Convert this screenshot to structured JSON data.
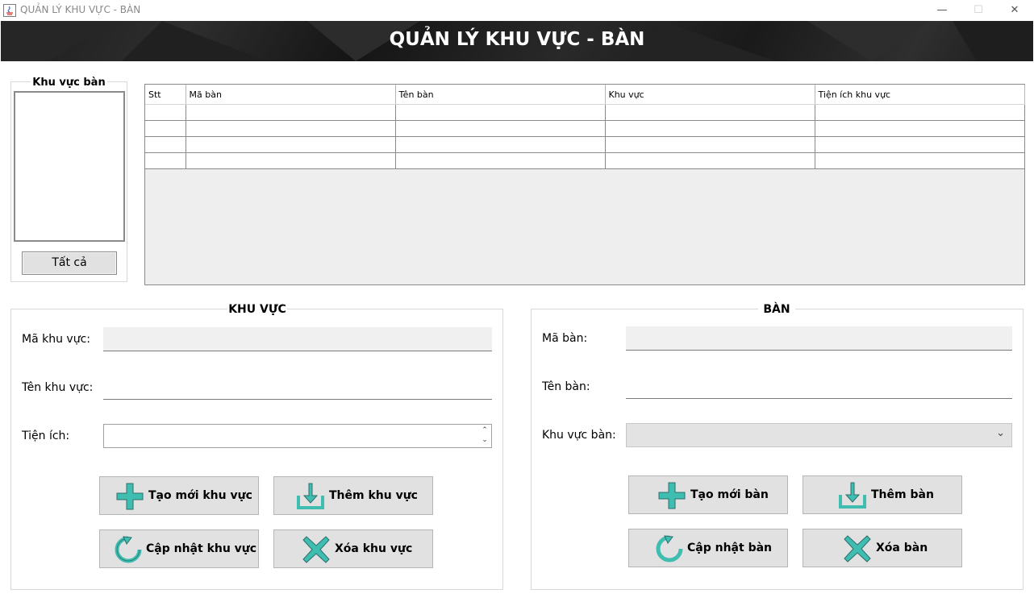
{
  "window": {
    "title": "QUẢN LÝ KHU VỰC - BÀN"
  },
  "window_controls": {
    "minimize": "—",
    "maximize": "☐",
    "close": "✕"
  },
  "banner": {
    "title": "QUẢN LÝ KHU VỰC - BÀN"
  },
  "area_panel": {
    "title": "Khu vực bàn",
    "all_button": "Tất cả"
  },
  "table": {
    "columns": [
      "Stt",
      "Mã bàn",
      "Tên bàn",
      "Khu vực",
      "Tiện ích khu vực"
    ],
    "rows": [
      [
        "",
        "",
        "",
        "",
        ""
      ],
      [
        "",
        "",
        "",
        "",
        ""
      ],
      [
        "",
        "",
        "",
        "",
        ""
      ],
      [
        "",
        "",
        "",
        "",
        ""
      ]
    ]
  },
  "area_form": {
    "title": "KHU VỰC",
    "code_label": "Mã khu vực:",
    "code_value": "",
    "name_label": "Tên khu vực:",
    "name_value": "",
    "utility_label": "Tiện ích:",
    "utility_value": "",
    "buttons": {
      "new": "Tạo mới khu vực",
      "add": "Thêm khu vực",
      "update": "Cập nhật khu vực",
      "delete": "Xóa khu vực"
    }
  },
  "table_form": {
    "title": "BÀN",
    "code_label": "Mã bàn:",
    "code_value": "",
    "name_label": "Tên bàn:",
    "name_value": "",
    "area_label": "Khu vực bàn:",
    "area_value": "",
    "buttons": {
      "new": "Tạo mới bàn",
      "add": "Thêm bàn",
      "update": "Cập nhật bàn",
      "delete": "Xóa bàn"
    }
  },
  "icons": {
    "new": "plus-icon",
    "add": "download-icon",
    "update": "refresh-icon",
    "delete": "x-icon"
  },
  "colors": {
    "accent": "#3fbdb1",
    "icon_stroke": "#2b6e6a",
    "banner": "#1f1f1f"
  }
}
